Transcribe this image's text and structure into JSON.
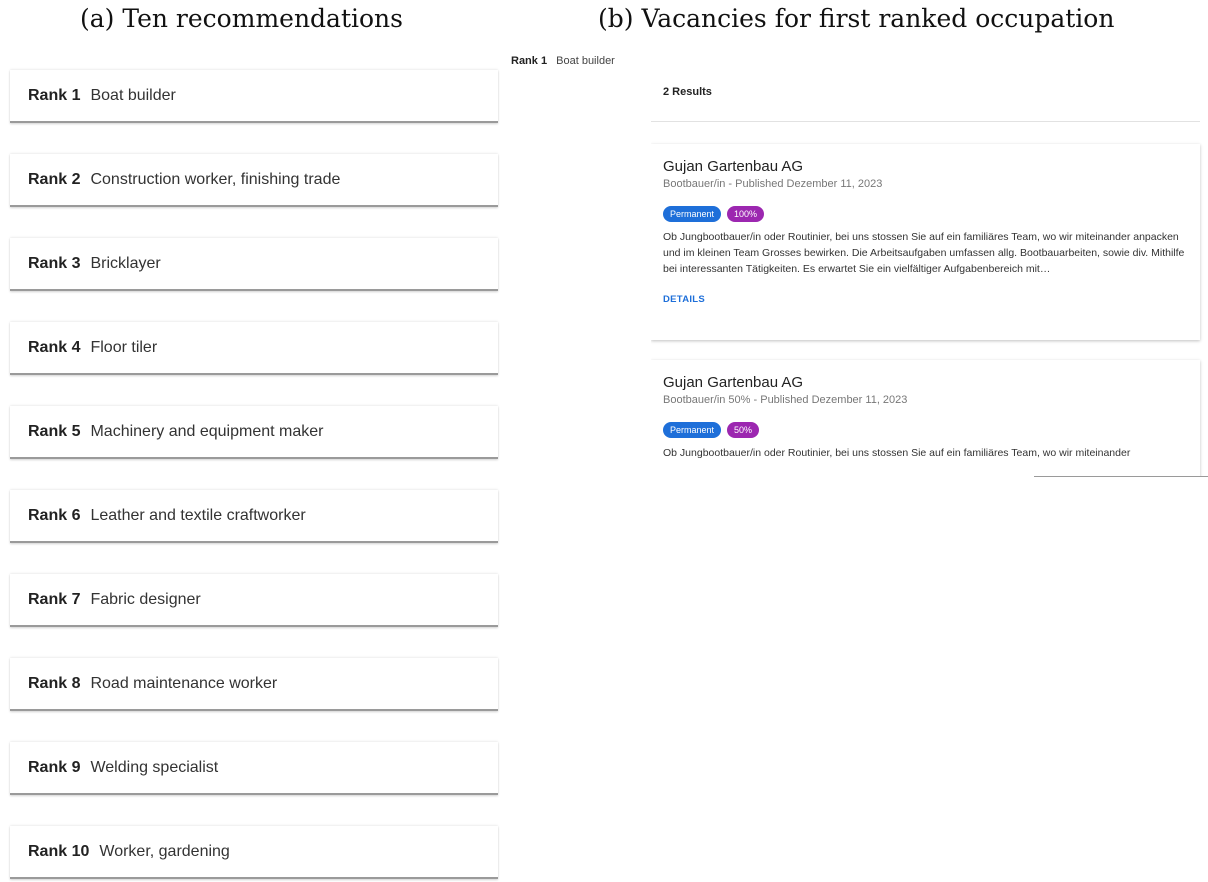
{
  "captions": {
    "a": "(a) Ten recommendations",
    "b": "(b) Vacancies for first ranked occupation"
  },
  "ranks": [
    {
      "rank": "Rank 1",
      "occupation": "Boat builder"
    },
    {
      "rank": "Rank 2",
      "occupation": "Construction worker, finishing trade"
    },
    {
      "rank": "Rank 3",
      "occupation": "Bricklayer"
    },
    {
      "rank": "Rank 4",
      "occupation": "Floor tiler"
    },
    {
      "rank": "Rank 5",
      "occupation": "Machinery and equipment maker"
    },
    {
      "rank": "Rank 6",
      "occupation": "Leather and textile craftworker"
    },
    {
      "rank": "Rank 7",
      "occupation": "Fabric designer"
    },
    {
      "rank": "Rank 8",
      "occupation": "Road maintenance worker"
    },
    {
      "rank": "Rank 9",
      "occupation": "Welding specialist"
    },
    {
      "rank": "Rank 10",
      "occupation": "Worker, gardening"
    }
  ],
  "panel_b": {
    "rank": "Rank 1",
    "occupation": "Boat builder",
    "results_count": "2 Results",
    "vacancies": [
      {
        "company": "Gujan Gartenbau AG",
        "subtitle": "Bootbauer/in - Published Dezember 11, 2023",
        "tag_type": "Permanent",
        "tag_workload": "100%",
        "description": "Ob Jungbootbauer/in oder Routinier, bei uns stossen Sie auf ein familiäres Team, wo wir miteinander anpacken und im kleinen Team Grosses bewirken. Die Arbeitsaufgaben umfassen allg. Bootbauarbeiten, sowie div. Mithilfe bei interessanten Tätigkeiten. Es erwartet Sie ein vielfältiger Aufgabenbereich mit…",
        "details_label": "DETAILS"
      },
      {
        "company": "Gujan Gartenbau AG",
        "subtitle": "Bootbauer/in 50% - Published Dezember 11, 2023",
        "tag_type": "Permanent",
        "tag_workload": "50%",
        "description": "Ob Jungbootbauer/in oder Routinier, bei uns stossen Sie auf ein familiäres Team, wo wir miteinander",
        "details_label": ""
      }
    ]
  },
  "colors": {
    "tag_permanent": "#1e6fd9",
    "tag_workload": "#9c27b0",
    "details_link": "#1e6fd9"
  }
}
